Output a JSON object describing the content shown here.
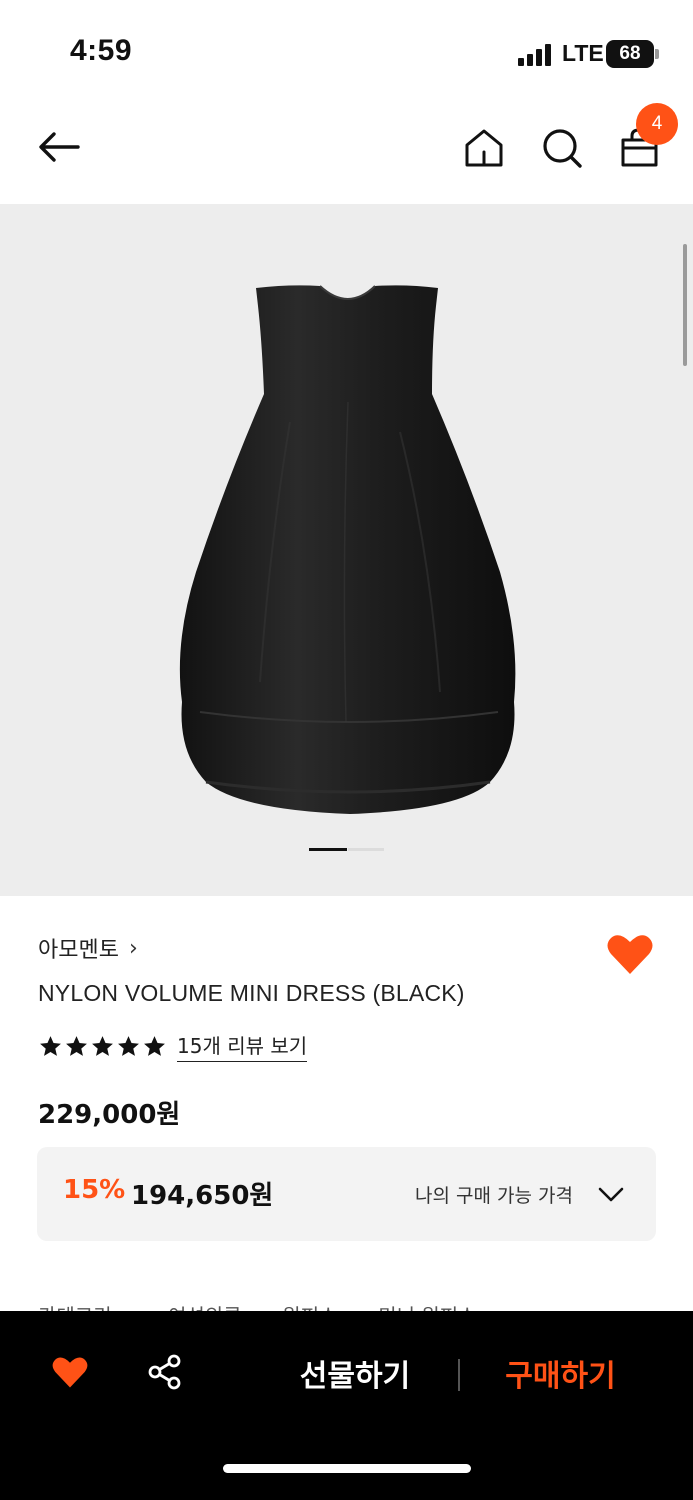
{
  "status_bar": {
    "time": "4:59",
    "carrier": "LTE",
    "battery": "68"
  },
  "header": {
    "back_icon": "arrow-left-icon",
    "home_icon": "home-icon",
    "search_icon": "search-icon",
    "cart_icon": "shopping-bag-icon",
    "cart_count": "4"
  },
  "gallery": {
    "image_subject": "black nylon volume mini dress",
    "page_count": 2,
    "current_page": 1
  },
  "product": {
    "brand": "아모멘토",
    "name": "NYLON VOLUME MINI DRESS (BLACK)",
    "rating_stars": 5,
    "review_link": "15개 리뷰 보기",
    "price": "229,000원",
    "wishlisted": true
  },
  "price_box": {
    "discount_rate": "15%",
    "discount_price": "194,650원",
    "my_price_label": "나의 구매 가능 가격"
  },
  "category": {
    "label": "카테고리",
    "path": [
      "여성의류",
      "원피스",
      "미니 원피스"
    ]
  },
  "bottom_bar": {
    "gift_label": "선물하기",
    "buy_label": "구매하기"
  },
  "colors": {
    "accent": "#ff5216",
    "bottom_bar_bg": "#000000",
    "gallery_bg": "#ededed",
    "price_box_bg": "#f3f3f3"
  }
}
